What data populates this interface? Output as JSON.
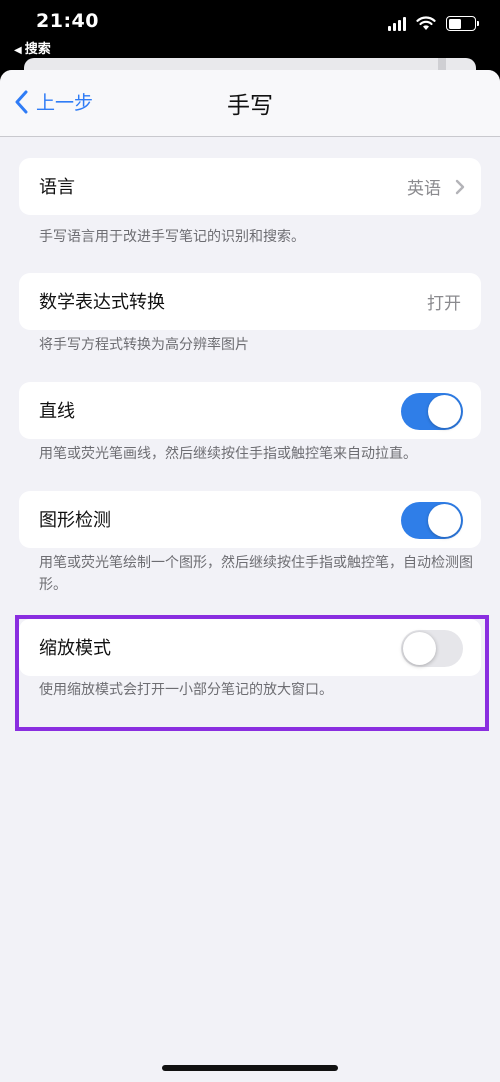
{
  "status_bar": {
    "time": "21:40",
    "back_app": "搜索"
  },
  "nav": {
    "back_label": "上一步",
    "title": "手写"
  },
  "settings": {
    "language": {
      "label": "语言",
      "value": "英语",
      "footer": "手写语言用于改进手写笔记的识别和搜索。"
    },
    "math": {
      "label": "数学表达式转换",
      "value": "打开",
      "footer": "将手写方程式转换为高分辨率图片"
    },
    "straight_line": {
      "label": "直线",
      "on": true,
      "footer": "用笔或荧光笔画线，然后继续按住手指或触控笔来自动拉直。"
    },
    "shape_detect": {
      "label": "图形检测",
      "on": true,
      "footer": "用笔或荧光笔绘制一个图形，然后继续按住手指或触控笔，自动检测图形。"
    },
    "zoom_mode": {
      "label": "缩放模式",
      "on": false,
      "footer": "使用缩放模式会打开一小部分笔记的放大窗口。"
    }
  },
  "colors": {
    "accent": "#2f7cf6",
    "switch_on": "#2f7ee8",
    "highlight": "#8a2ee0"
  }
}
